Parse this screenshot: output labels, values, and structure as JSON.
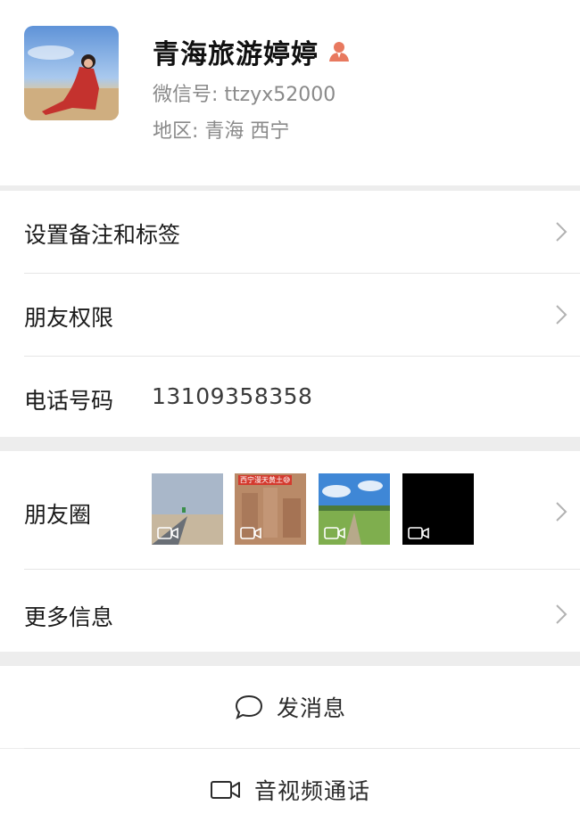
{
  "profile": {
    "name": "青海旅游婷婷",
    "wechat_id": "微信号: ttzyx52000",
    "region": "地区: 青海  西宁"
  },
  "rows": {
    "remark_tags": "设置备注和标签",
    "permissions": "朋友权限",
    "phone_label": "电话号码",
    "phone_value": "13109358358",
    "moments": "朋友圈",
    "more_info": "更多信息"
  },
  "moments_thumbs": [
    {
      "icon": "video-icon"
    },
    {
      "caption": "西宁漫天黄土😅",
      "icon": "video-icon"
    },
    {
      "icon": "video-icon"
    },
    {
      "icon": "video-icon"
    }
  ],
  "actions": {
    "send_message": "发消息",
    "av_call": "音视频通话"
  },
  "colors": {
    "background": "#ededed",
    "surface": "#ffffff",
    "secondary_text": "#8a8a8a",
    "person_icon": "#e8795f"
  }
}
